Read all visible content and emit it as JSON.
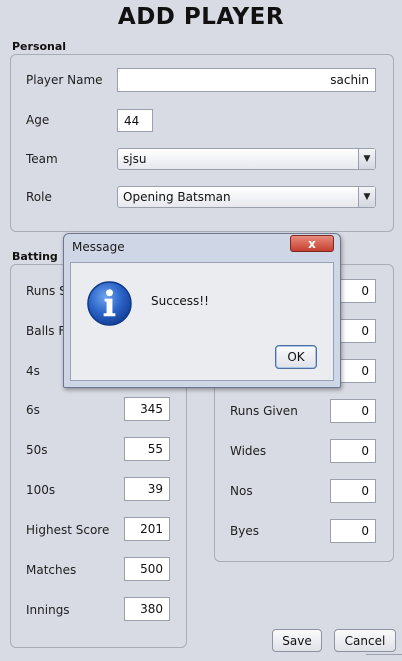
{
  "title": "ADD PLAYER",
  "personal": {
    "label": "Personal",
    "player_name_label": "Player Name",
    "player_name_value": "sachin",
    "age_label": "Age",
    "age_value": "44",
    "team_label": "Team",
    "team_value": "sjsu",
    "role_label": "Role",
    "role_value": "Opening Batsman"
  },
  "batting": {
    "label": "Batting",
    "runs_scored_label": "Runs Scored",
    "balls_faced_label": "Balls Faced",
    "fours_label": "4s",
    "sixes_label": "6s",
    "sixes_value": "345",
    "fifties_label": "50s",
    "fifties_value": "55",
    "hundreds_label": "100s",
    "hundreds_value": "39",
    "highest_score_label": "Highest Score",
    "highest_score_value": "201",
    "matches_label": "Matches",
    "matches_value": "500",
    "innings_label": "Innings",
    "innings_value": "380"
  },
  "bowling": {
    "row1_value": "0",
    "row2_value": "0",
    "row3_value": "0",
    "runs_given_label": "Runs Given",
    "runs_given_value": "0",
    "wides_label": "Wides",
    "wides_value": "0",
    "nos_label": "Nos",
    "nos_value": "0",
    "byes_label": "Byes",
    "byes_value": "0"
  },
  "buttons": {
    "save": "Save",
    "cancel": "Cancel"
  },
  "dialog": {
    "title": "Message",
    "close_glyph": "x",
    "message": "Success!!",
    "ok": "OK",
    "icon": "info-icon"
  },
  "colors": {
    "background": "#d8dbe3",
    "info_icon": "#1f57b8",
    "close_button": "#c5402f"
  }
}
